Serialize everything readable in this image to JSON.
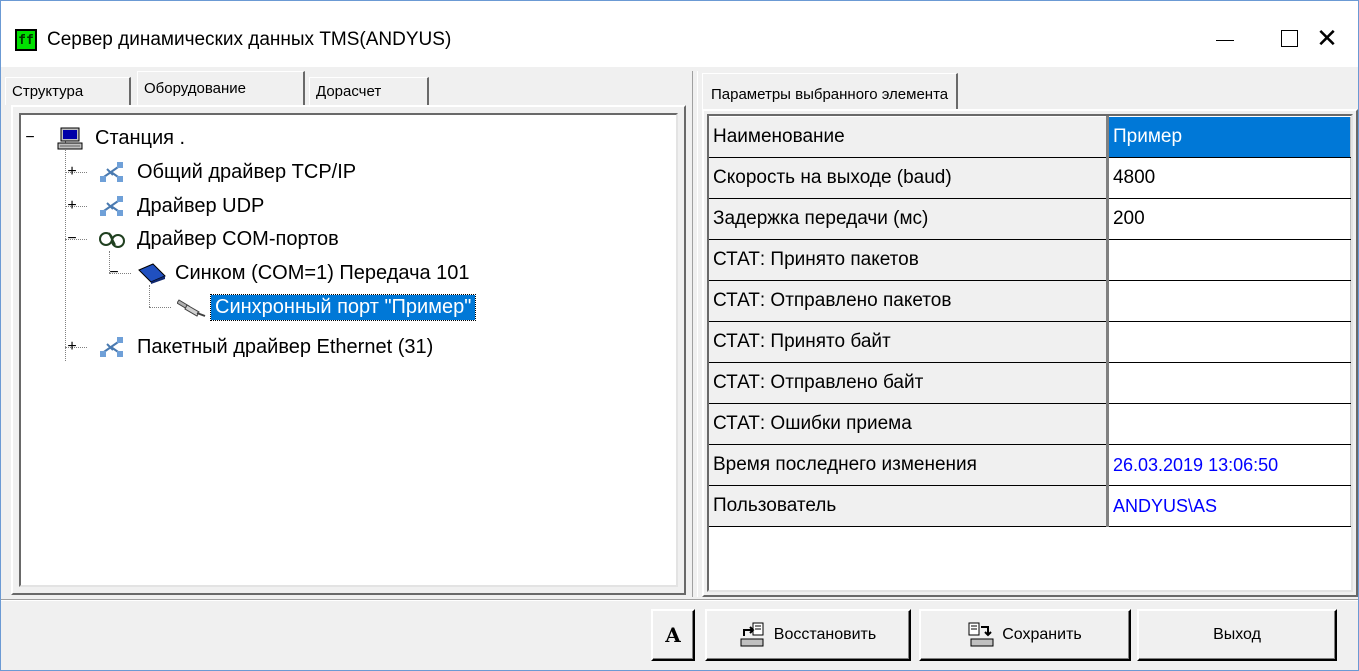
{
  "window": {
    "title": "Сервер динамических данных TMS(ANDYUS)",
    "icon_letter": "ff",
    "controls": {
      "minimize": "—",
      "maximize": "☐",
      "close": "✕"
    }
  },
  "left_tabs": [
    "Структура",
    "Оборудование",
    "Дорасчет"
  ],
  "left_active_tab": "Оборудование",
  "tree": [
    {
      "label": "Станция .",
      "icon": "computer-icon",
      "expander": "−"
    },
    {
      "label": "Общий драйвер TCP/IP",
      "icon": "network-icon",
      "expander": "+"
    },
    {
      "label": "Драйвер UDP",
      "icon": "network-icon",
      "expander": "+"
    },
    {
      "label": "Драйвер COM-портов",
      "icon": "com-port-icon",
      "expander": "−"
    },
    {
      "label": "Синком  (COM=1) Передача 101",
      "icon": "modem-icon",
      "expander": "−"
    },
    {
      "label": "Синхронный порт  \"Пример\"",
      "icon": "plug-icon",
      "expander": "",
      "selected": true
    },
    {
      "label": "Пакетный драйвер Ethernet  (31)",
      "icon": "network-icon",
      "expander": "+"
    }
  ],
  "right_tab": "Параметры выбранного элемента",
  "properties": [
    {
      "name": "Наименование",
      "value": "Пример"
    },
    {
      "name": "Скорость на выходе (baud)",
      "value": "4800"
    },
    {
      "name": "Задержка передачи (мс)",
      "value": "200"
    },
    {
      "name": "СТАТ: Принято пакетов",
      "value": ""
    },
    {
      "name": "СТАТ: Отправлено пакетов",
      "value": ""
    },
    {
      "name": "СТАТ: Принято байт",
      "value": ""
    },
    {
      "name": "СТАТ: Отправлено байт",
      "value": ""
    },
    {
      "name": "СТАТ: Ошибки приема",
      "value": ""
    },
    {
      "name": "Время последнего изменения",
      "value": "26.03.2019 13:06:50"
    },
    {
      "name": "Пользователь",
      "value": "ANDYUS\\AS"
    }
  ],
  "buttons": {
    "font": "A",
    "restore": "Восстановить",
    "save": "Сохранить",
    "exit": "Выход"
  },
  "colors": {
    "selection": "#0078d7",
    "link_value": "#0000ff",
    "app_icon": "#00e000"
  }
}
